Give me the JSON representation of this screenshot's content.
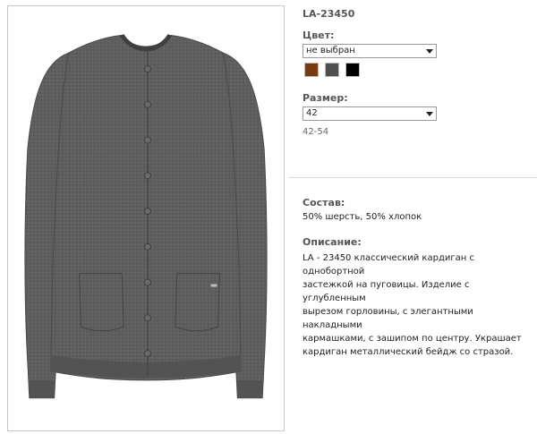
{
  "product": {
    "sku": "LA-23450",
    "image_alt": "cardigan-photo"
  },
  "color": {
    "label": "Цвет:",
    "select_value": "не выбран",
    "swatches": [
      {
        "name": "brown",
        "hex": "#7a3a10"
      },
      {
        "name": "dark-gray",
        "hex": "#4f4f4f"
      },
      {
        "name": "black",
        "hex": "#000000"
      }
    ]
  },
  "size": {
    "label": "Размер:",
    "select_value": "42",
    "range": "42-54"
  },
  "composition": {
    "label": "Состав:",
    "value": "50% шерсть, 50% хлопок"
  },
  "description": {
    "label": "Описание:",
    "lines": [
      "LA - 23450 классический кардиган с однобортной",
      "застежкой на пуговицы. Изделие с углубленным",
      "вырезом горловины, с элегантными накладными",
      "кармашками, с зашипом по центру. Украшает",
      "кардиган металлический бейдж со стразой."
    ]
  },
  "colors": {
    "text": "#555555",
    "garment": "#5e5e5e"
  }
}
